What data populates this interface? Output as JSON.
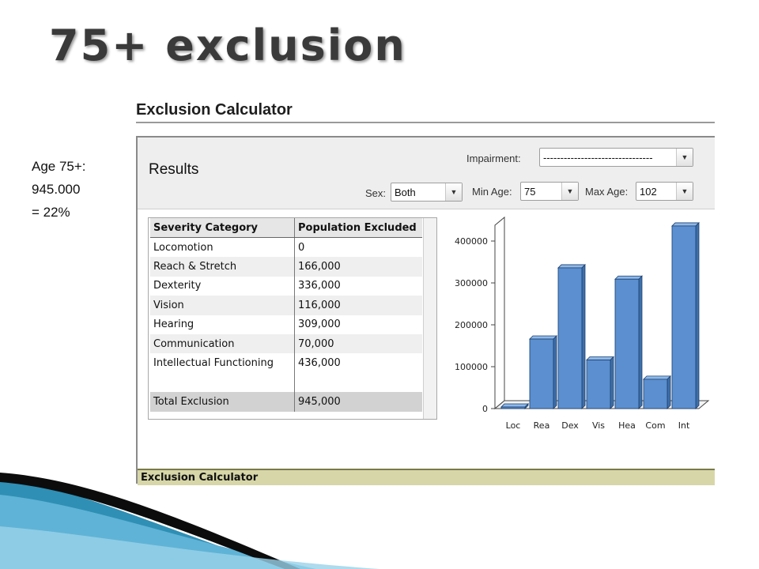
{
  "slide": {
    "title": "75+ exclusion",
    "note_line1": "Age 75+:",
    "note_line2": "945.000",
    "note_line3": "= 22%"
  },
  "app": {
    "header_title": "Exclusion Calculator",
    "results_title": "Results",
    "status_text": "Exclusion Calculator"
  },
  "controls": {
    "impairment_label": "Impairment:",
    "impairment_value": "--------------------------------",
    "sex_label": "Sex:",
    "sex_value": "Both",
    "min_age_label": "Min Age:",
    "min_age_value": "75",
    "max_age_label": "Max Age:",
    "max_age_value": "102"
  },
  "table": {
    "headers": [
      "Severity Category",
      "Population Excluded"
    ],
    "rows": [
      [
        "Locomotion",
        "0"
      ],
      [
        "Reach & Stretch",
        "166,000"
      ],
      [
        "Dexterity",
        "336,000"
      ],
      [
        "Vision",
        "116,000"
      ],
      [
        "Hearing",
        "309,000"
      ],
      [
        "Communication",
        "70,000"
      ],
      [
        "Intellectual Functioning",
        "436,000"
      ],
      [
        "",
        ""
      ],
      [
        "Total Exclusion",
        "945,000"
      ]
    ]
  },
  "chart_data": {
    "type": "bar",
    "categories": [
      "Loc",
      "Rea",
      "Dex",
      "Vis",
      "Hea",
      "Com",
      "Int"
    ],
    "values": [
      0,
      166000,
      336000,
      116000,
      309000,
      70000,
      436000
    ],
    "ylim": [
      0,
      400000
    ],
    "yticks": [
      "0",
      "100000",
      "200000",
      "300000",
      "400000"
    ],
    "bar_color": "#5b8fcf"
  },
  "colors": {
    "status_bar": "#d6d6a8",
    "bar_fill": "#5b8fcf"
  }
}
